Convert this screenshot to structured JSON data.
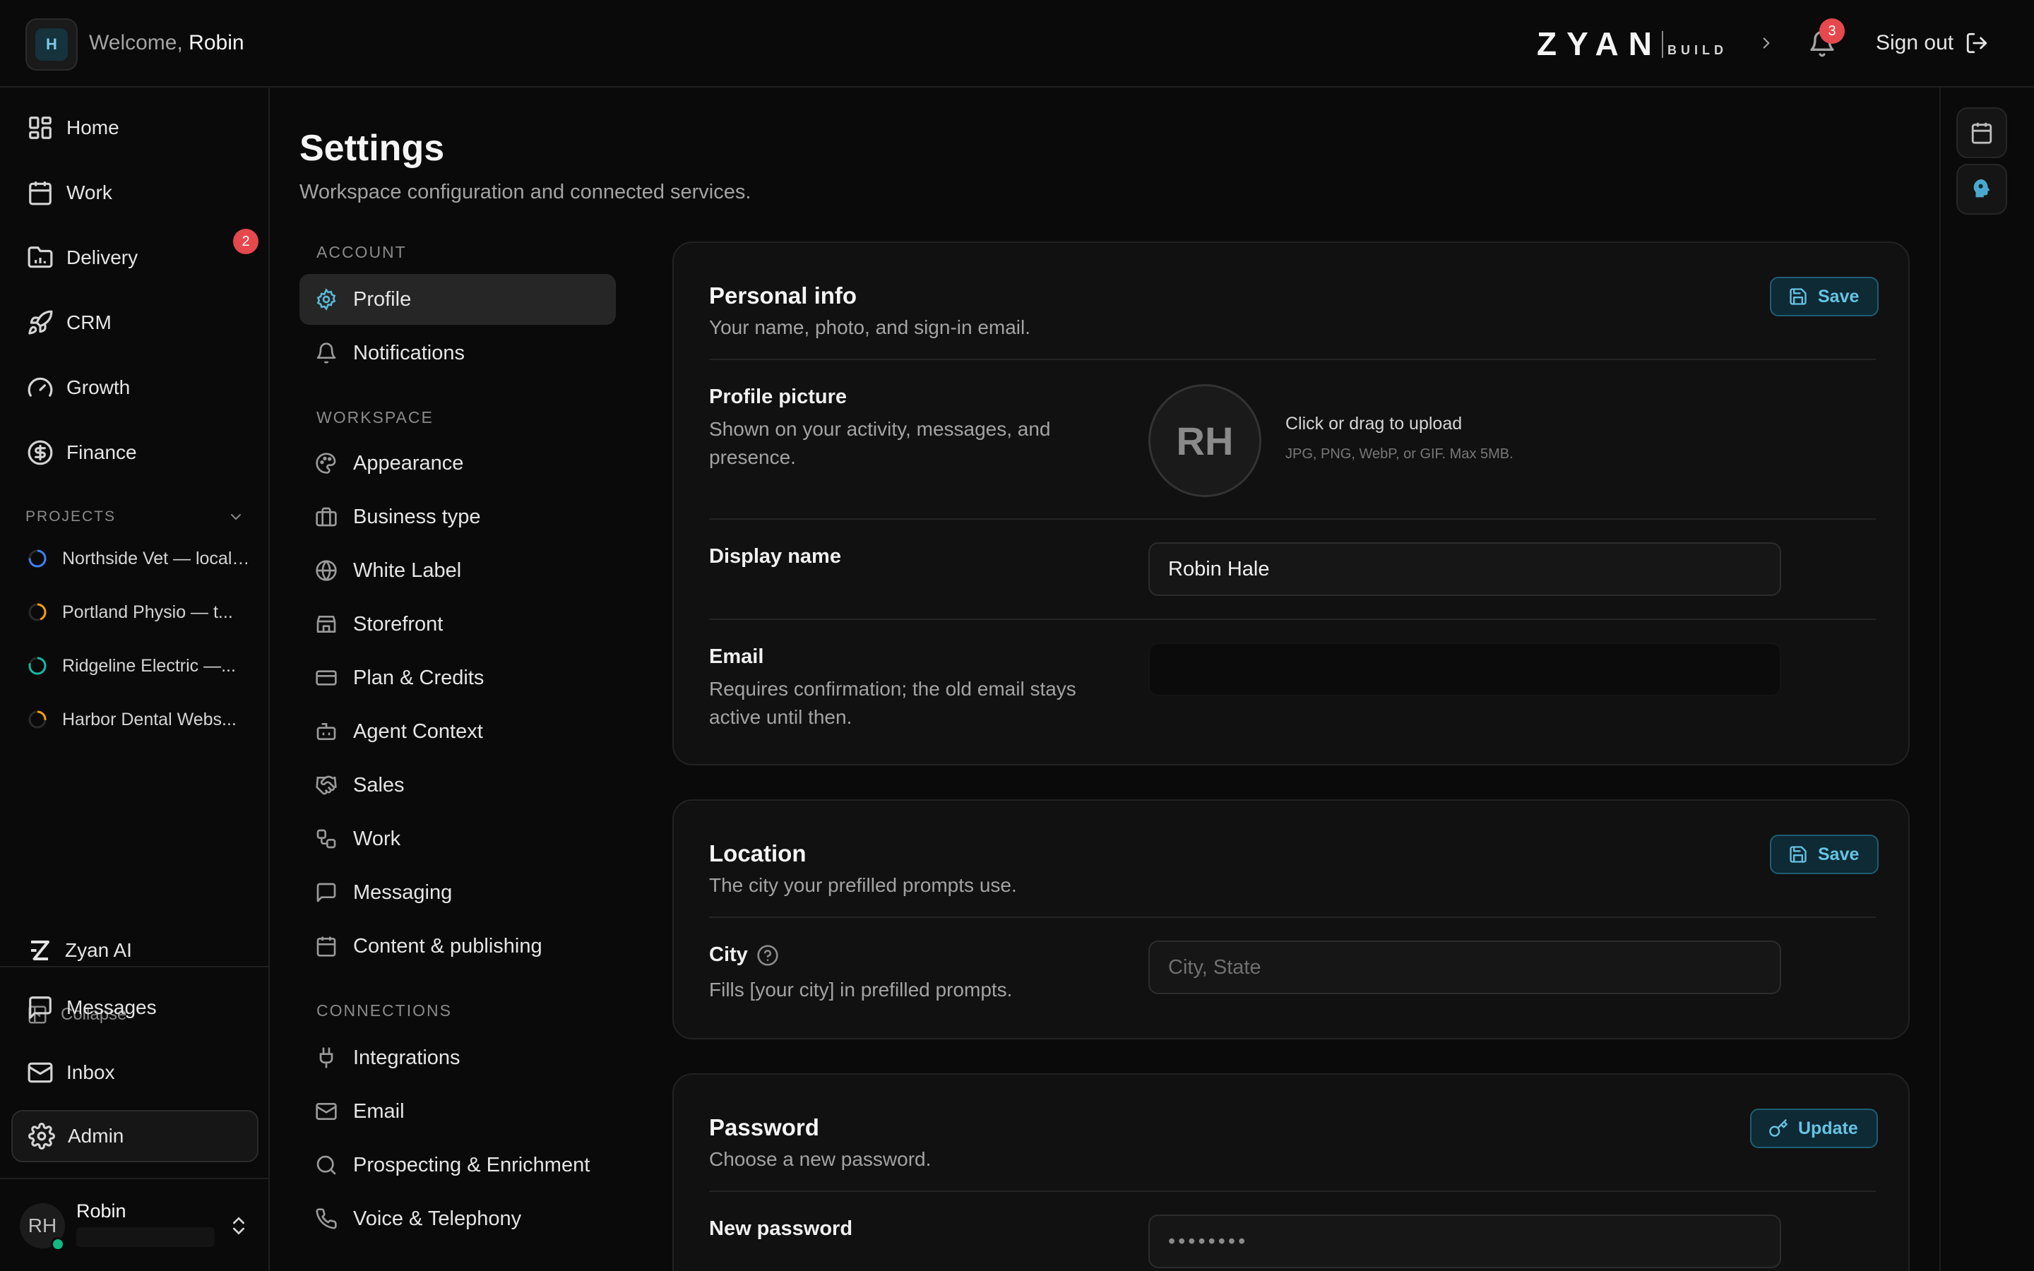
{
  "topbar": {
    "workspace_initial": "H",
    "welcome_prefix": "Welcome,",
    "user_first_name": "Robin",
    "brand": "ZYAN",
    "brand_sub": "BUILD",
    "notifications_count": "3",
    "sign_out": "Sign out"
  },
  "sidebar": {
    "nav": [
      {
        "label": "Home",
        "icon": "grid-icon"
      },
      {
        "label": "Work",
        "icon": "calendar-icon"
      },
      {
        "label": "Delivery",
        "icon": "folder-chart-icon",
        "badge": "2"
      },
      {
        "label": "CRM",
        "icon": "rocket-icon"
      },
      {
        "label": "Growth",
        "icon": "gauge-icon"
      },
      {
        "label": "Finance",
        "icon": "dollar-circle-icon"
      }
    ],
    "projects_heading": "PROJECTS",
    "projects": [
      {
        "name": "Northside Vet — local SEO",
        "color": "#3b82f6"
      },
      {
        "name": "Portland Physio — t...",
        "color": "#f59e0b"
      },
      {
        "name": "Ridgeline Electric —...",
        "color": "#14b8a6"
      },
      {
        "name": "Harbor Dental Webs...",
        "color": "#f59e0b"
      }
    ],
    "zyan_ai": "Zyan AI",
    "collapse": "Collapse",
    "bottom_nav": [
      {
        "label": "Messages",
        "icon": "chat-icon"
      },
      {
        "label": "Inbox",
        "icon": "mail-icon"
      },
      {
        "label": "Admin",
        "icon": "gear-icon"
      }
    ],
    "user": {
      "initials": "RH",
      "name": "Robin"
    }
  },
  "page": {
    "title": "Settings",
    "subtitle": "Workspace configuration and connected services."
  },
  "settings_nav": {
    "account_heading": "ACCOUNT",
    "account": [
      "Profile",
      "Notifications"
    ],
    "workspace_heading": "WORKSPACE",
    "workspace": [
      "Appearance",
      "Business type",
      "White Label",
      "Storefront",
      "Plan & Credits",
      "Agent Context",
      "Sales",
      "Work",
      "Messaging",
      "Content & publishing"
    ],
    "connections_heading": "CONNECTIONS",
    "connections": [
      "Integrations",
      "Email",
      "Prospecting & Enrichment",
      "Voice & Telephony"
    ]
  },
  "personal": {
    "title": "Personal info",
    "subtitle": "Your name, photo, and sign-in email.",
    "save": "Save",
    "pic_label": "Profile picture",
    "pic_help": "Shown on your activity, messages, and presence.",
    "avatar_initials": "RH",
    "upload_title": "Click or drag to upload",
    "upload_hint": "JPG, PNG, WebP, or GIF. Max 5MB.",
    "display_name_label": "Display name",
    "display_name_value": "Robin Hale",
    "email_label": "Email",
    "email_help": "Requires confirmation; the old email stays active until then."
  },
  "location": {
    "title": "Location",
    "subtitle": "The city your prefilled prompts use.",
    "save": "Save",
    "city_label": "City",
    "city_help": "Fills [your city] in prefilled prompts.",
    "city_placeholder": "City, State"
  },
  "password": {
    "title": "Password",
    "subtitle": "Choose a new password.",
    "update": "Update",
    "new_label": "New password",
    "new_value": "••••••••"
  },
  "colors": {
    "accent": "#67c3e3",
    "badge": "#e5484d",
    "online": "#10b981"
  }
}
